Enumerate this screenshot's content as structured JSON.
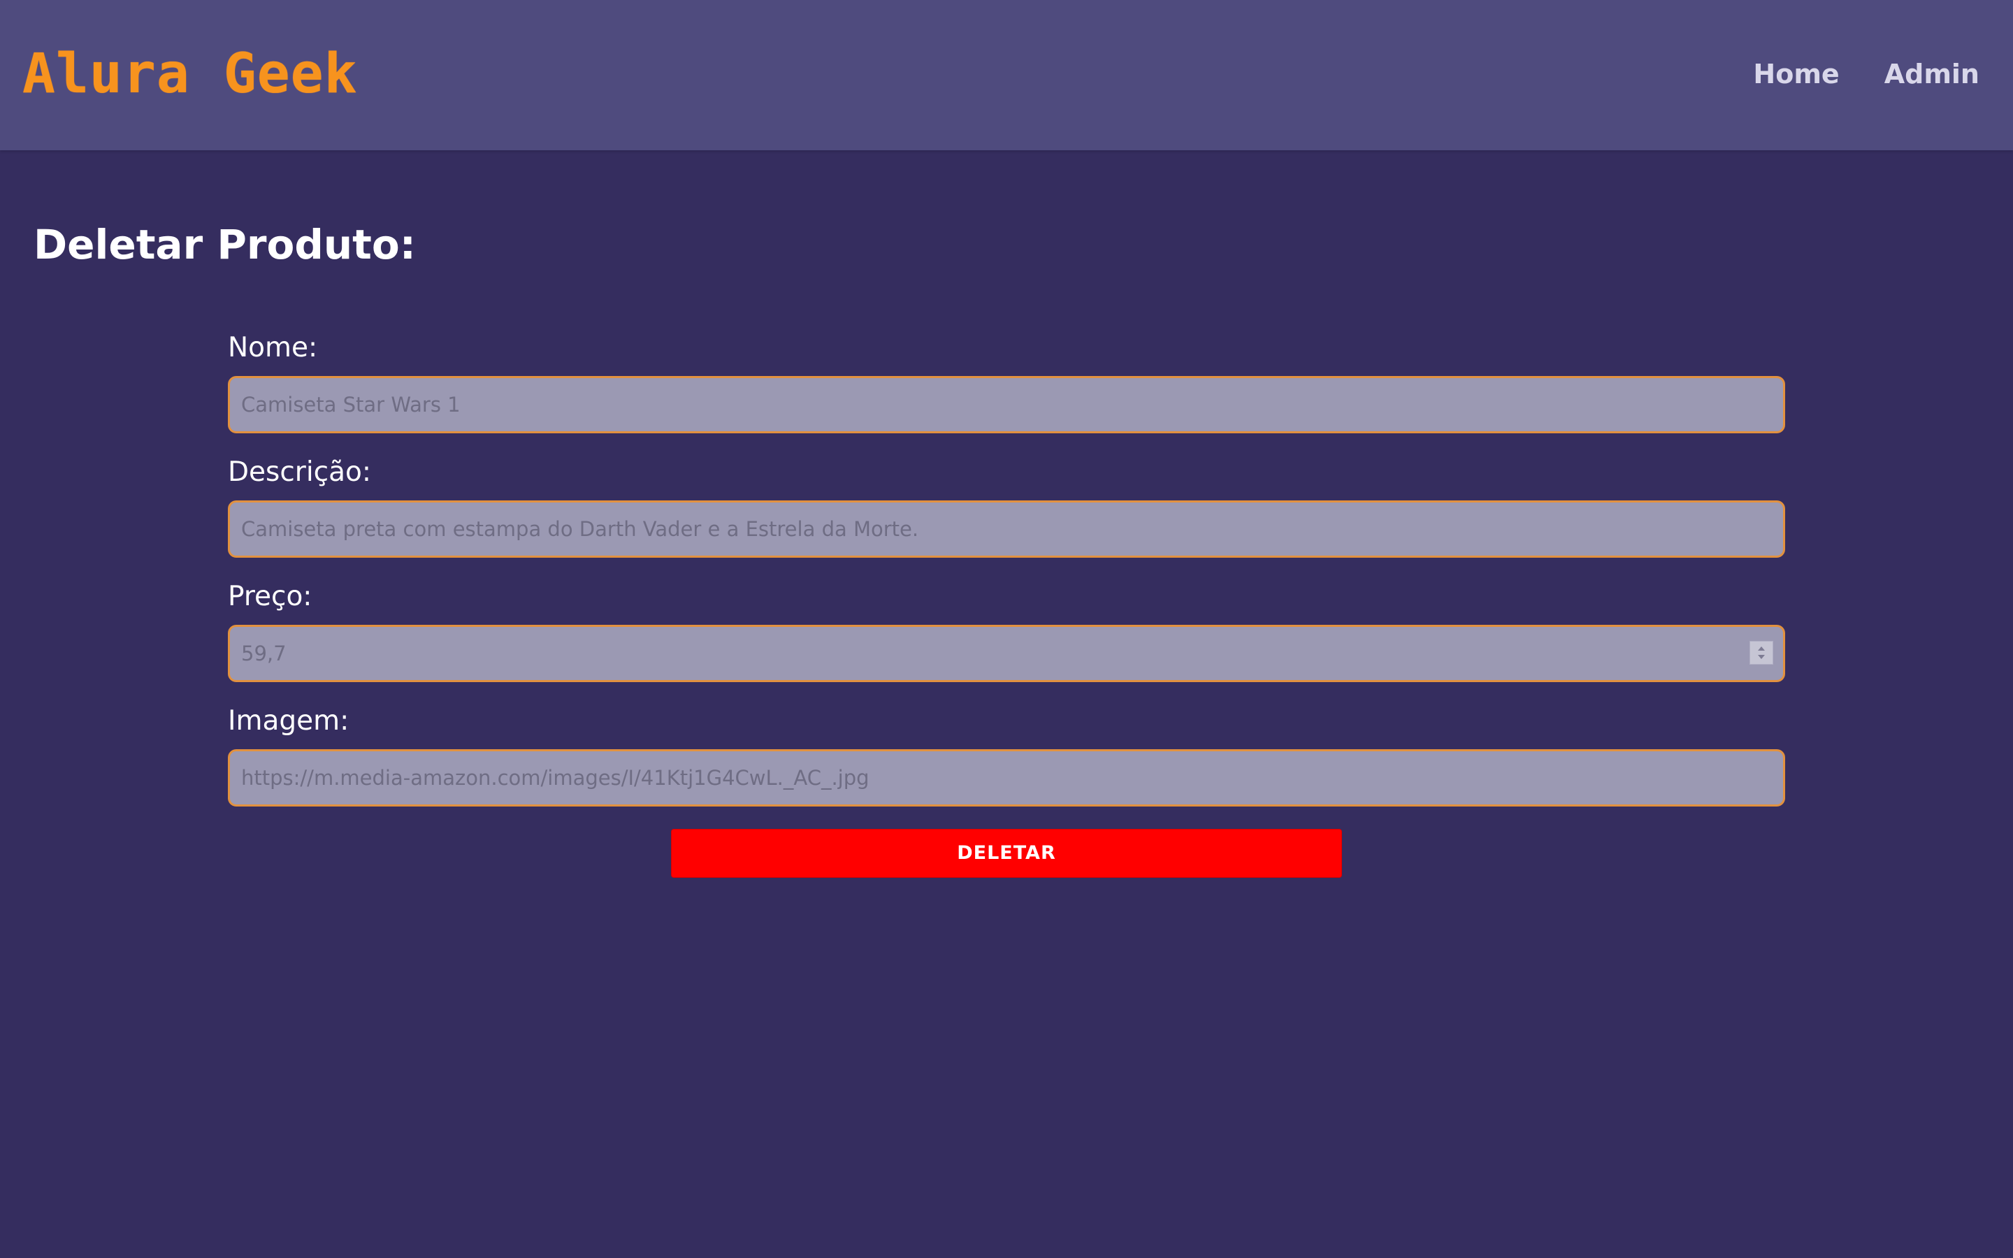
{
  "header": {
    "logo": "Alura Geek",
    "nav": {
      "home": "Home",
      "admin": "Admin"
    }
  },
  "main": {
    "title": "Deletar Produto:",
    "form": {
      "nome": {
        "label": "Nome:",
        "value": "Camiseta Star Wars 1"
      },
      "descricao": {
        "label": "Descrição:",
        "value": "Camiseta preta com estampa do Darth Vader e a Estrela da Morte."
      },
      "preco": {
        "label": "Preço:",
        "value": "59,7"
      },
      "imagem": {
        "label": "Imagem:",
        "value": "https://m.media-amazon.com/images/I/41Ktj1G4CwL._AC_.jpg"
      }
    },
    "delete_button": "DELETAR"
  },
  "colors": {
    "background": "#352d5f",
    "header": "#4f4b7e",
    "accent": "#f7931e",
    "danger": "#ff0000",
    "input_background": "#9b99b3"
  }
}
